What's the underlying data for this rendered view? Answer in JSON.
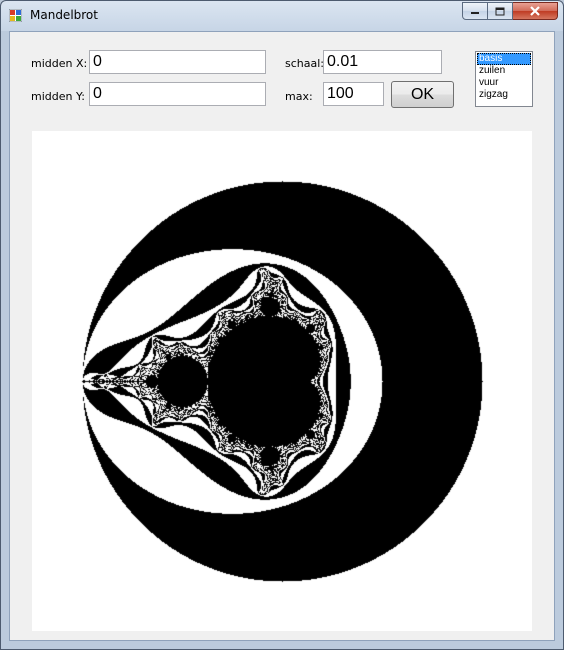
{
  "window": {
    "title": "Mandelbrot"
  },
  "form": {
    "midden_x_label": "midden X:",
    "midden_x_value": "0",
    "midden_y_label": "midden Y:",
    "midden_y_value": "0",
    "schaal_label": "schaal:",
    "schaal_value": "0.01",
    "max_label": "max:",
    "max_value": "100",
    "ok_label": "OK"
  },
  "color_modes": {
    "items": [
      "basis",
      "zuilen",
      "vuur",
      "zigzag"
    ],
    "selected": "basis"
  },
  "colors": {
    "selection": "#3399ff",
    "fractal_inside": "#000000",
    "fractal_outside_even": "#ffffff"
  }
}
